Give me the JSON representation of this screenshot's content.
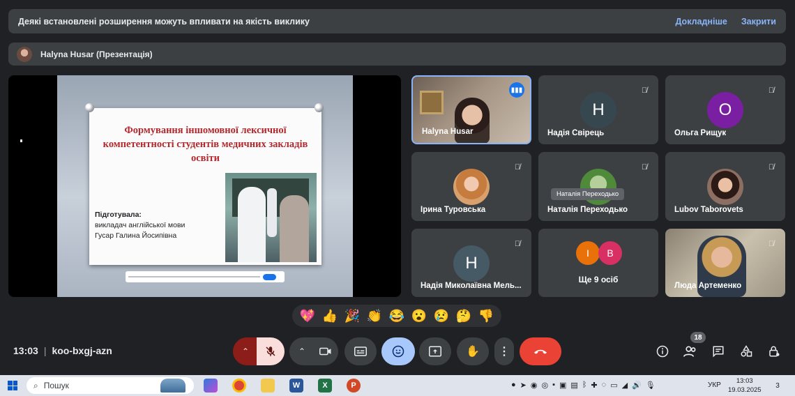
{
  "banner": {
    "message": "Деякі встановлені розширення можуть впливати на якість виклику",
    "learn_more": "Докладніше",
    "close": "Закрити"
  },
  "presenter": {
    "label": "Halyna Husar (Презентація)"
  },
  "slide": {
    "title": "Формування іншомовної лексичної компетентності студентів медичних закладів освіти",
    "prepared_by": "Підготувала:",
    "author_role": "викладач англійської мови",
    "author_name": "Гусар Галина Йосипівна"
  },
  "participants": [
    {
      "name": "Halyna Husar",
      "type": "video",
      "speaking": true
    },
    {
      "name": "Надія Свірець",
      "initial": "Н",
      "color": "#37474f",
      "muted": true
    },
    {
      "name": "Ольга Рищук",
      "initial": "О",
      "color": "#7b1fa2",
      "muted": true
    },
    {
      "name": "Ірина Туровська",
      "type": "photo",
      "muted": true
    },
    {
      "name": "Наталія Переходько",
      "type": "photo",
      "muted": true,
      "tooltip": "Наталія Переходько"
    },
    {
      "name": "Lubov Taborovets",
      "type": "photo",
      "muted": true
    },
    {
      "name": "Надія Миколаївна Мель...",
      "initial": "Н",
      "color": "#455a64",
      "muted": true
    },
    {
      "name": "Ще 9 осіб",
      "type": "more",
      "avatars": [
        {
          "initial": "І",
          "color": "#e8710a"
        },
        {
          "initial": "В",
          "color": "#d93063"
        }
      ]
    },
    {
      "name": "Люда Артеменко",
      "type": "video",
      "muted": true
    }
  ],
  "reactions": [
    "💖",
    "👍",
    "🎉",
    "👏",
    "😂",
    "😮",
    "😢",
    "🤔",
    "👎"
  ],
  "meeting": {
    "time": "13:03",
    "separator": "|",
    "code": "koo-bxgj-azn"
  },
  "people_count": "18",
  "taskbar": {
    "search_placeholder": "Пошук",
    "lang": "УКР",
    "time": "13:03",
    "date": "19.03.2025",
    "notif": "3"
  },
  "icons": {
    "mic_off": "mic-off-icon",
    "camera": "camera-icon",
    "captions": "captions-icon",
    "emoji": "emoji-icon",
    "present": "present-icon",
    "hand": "raise-hand-icon",
    "more": "more-icon",
    "hangup": "hangup-icon",
    "info": "info-icon",
    "people": "people-icon",
    "chat": "chat-icon",
    "activities": "activities-icon",
    "lock": "host-controls-icon"
  },
  "colors": {
    "bg": "#202124",
    "accent": "#8ab4f8",
    "hangup": "#ea4335",
    "emoji_active": "#a8c7fa",
    "mic_off_bg": "#f9dedc",
    "mic_off_chevron_bg": "#8c1d18"
  }
}
